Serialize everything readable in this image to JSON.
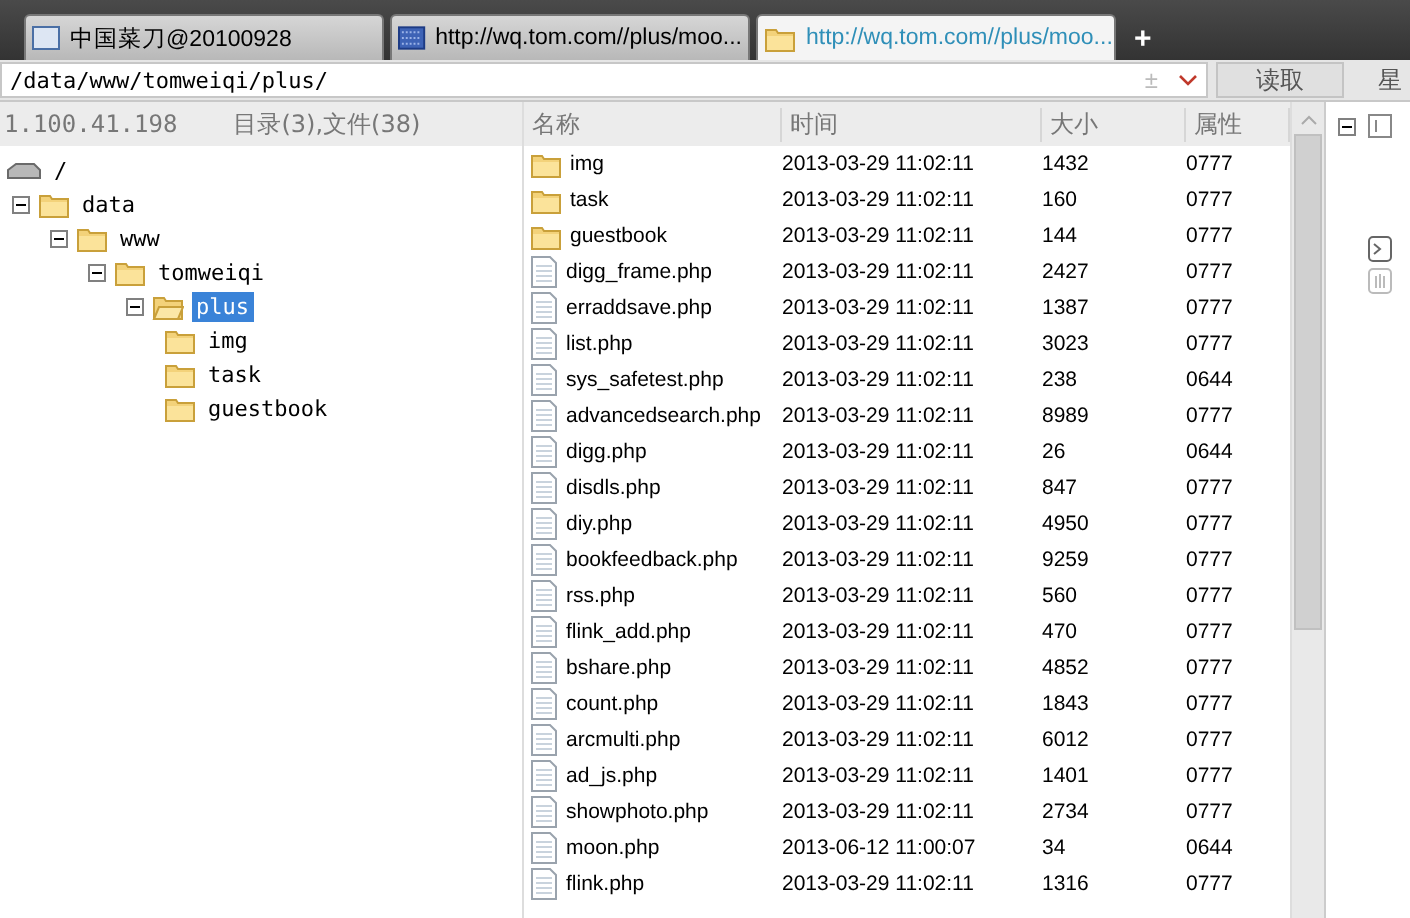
{
  "tabs": [
    {
      "label": "中国菜刀@20100928",
      "kind": "page",
      "selected": false
    },
    {
      "label": "http://wq.tom.com//plus/moo...",
      "kind": "grid",
      "selected": false
    },
    {
      "label": "http://wq.tom.com//plus/moo...",
      "kind": "folder",
      "selected": true
    }
  ],
  "new_tab": "+",
  "address": {
    "value": "/data/www/tomweiqi/plus/",
    "plusminus": "±",
    "button": "读取",
    "cut_label": "星"
  },
  "status": {
    "ip": "1.100.41.198",
    "counts": "目录(3),文件(38)"
  },
  "tree": [
    {
      "name": "/",
      "kind": "drive",
      "children": [
        {
          "name": "data",
          "kind": "folder",
          "expanded": true,
          "selected": false,
          "children": [
            {
              "name": "www",
              "kind": "folder",
              "expanded": true,
              "selected": false,
              "children": [
                {
                  "name": "tomweiqi",
                  "kind": "folder",
                  "expanded": true,
                  "selected": false,
                  "children": [
                    {
                      "name": "plus",
                      "kind": "folder",
                      "expanded": true,
                      "selected": true,
                      "children": [
                        {
                          "name": "img",
                          "kind": "folder",
                          "selected": false
                        },
                        {
                          "name": "task",
                          "kind": "folder",
                          "selected": false
                        },
                        {
                          "name": "guestbook",
                          "kind": "folder",
                          "selected": false
                        }
                      ]
                    }
                  ]
                }
              ]
            }
          ]
        }
      ]
    }
  ],
  "table": {
    "columns": [
      "名称",
      "时间",
      "大小",
      "属性"
    ],
    "rows": [
      {
        "kind": "folder",
        "name": "img",
        "time": "2013-03-29 11:02:11",
        "size": "1432",
        "mode": "0777"
      },
      {
        "kind": "folder",
        "name": "task",
        "time": "2013-03-29 11:02:11",
        "size": "160",
        "mode": "0777"
      },
      {
        "kind": "folder",
        "name": "guestbook",
        "time": "2013-03-29 11:02:11",
        "size": "144",
        "mode": "0777"
      },
      {
        "kind": "file",
        "name": "digg_frame.php",
        "time": "2013-03-29 11:02:11",
        "size": "2427",
        "mode": "0777"
      },
      {
        "kind": "file",
        "name": "erraddsave.php",
        "time": "2013-03-29 11:02:11",
        "size": "1387",
        "mode": "0777"
      },
      {
        "kind": "file",
        "name": "list.php",
        "time": "2013-03-29 11:02:11",
        "size": "3023",
        "mode": "0777"
      },
      {
        "kind": "file",
        "name": "sys_safetest.php",
        "time": "2013-03-29 11:02:11",
        "size": "238",
        "mode": "0644"
      },
      {
        "kind": "file",
        "name": "advancedsearch.php",
        "time": "2013-03-29 11:02:11",
        "size": "8989",
        "mode": "0777"
      },
      {
        "kind": "file",
        "name": "digg.php",
        "time": "2013-03-29 11:02:11",
        "size": "26",
        "mode": "0644"
      },
      {
        "kind": "file",
        "name": "disdls.php",
        "time": "2013-03-29 11:02:11",
        "size": "847",
        "mode": "0777"
      },
      {
        "kind": "file",
        "name": "diy.php",
        "time": "2013-03-29 11:02:11",
        "size": "4950",
        "mode": "0777"
      },
      {
        "kind": "file",
        "name": "bookfeedback.php",
        "time": "2013-03-29 11:02:11",
        "size": "9259",
        "mode": "0777"
      },
      {
        "kind": "file",
        "name": "rss.php",
        "time": "2013-03-29 11:02:11",
        "size": "560",
        "mode": "0777"
      },
      {
        "kind": "file",
        "name": "flink_add.php",
        "time": "2013-03-29 11:02:11",
        "size": "470",
        "mode": "0777"
      },
      {
        "kind": "file",
        "name": "bshare.php",
        "time": "2013-03-29 11:02:11",
        "size": "4852",
        "mode": "0777"
      },
      {
        "kind": "file",
        "name": "count.php",
        "time": "2013-03-29 11:02:11",
        "size": "1843",
        "mode": "0777"
      },
      {
        "kind": "file",
        "name": "arcmulti.php",
        "time": "2013-03-29 11:02:11",
        "size": "6012",
        "mode": "0777"
      },
      {
        "kind": "file",
        "name": "ad_js.php",
        "time": "2013-03-29 11:02:11",
        "size": "1401",
        "mode": "0777"
      },
      {
        "kind": "file",
        "name": "showphoto.php",
        "time": "2013-03-29 11:02:11",
        "size": "2734",
        "mode": "0777"
      },
      {
        "kind": "file",
        "name": "moon.php",
        "time": "2013-06-12 11:00:07",
        "size": "34",
        "mode": "0644"
      },
      {
        "kind": "file",
        "name": "flink.php",
        "time": "2013-03-29 11:02:11",
        "size": "1316",
        "mode": "0777"
      }
    ]
  }
}
